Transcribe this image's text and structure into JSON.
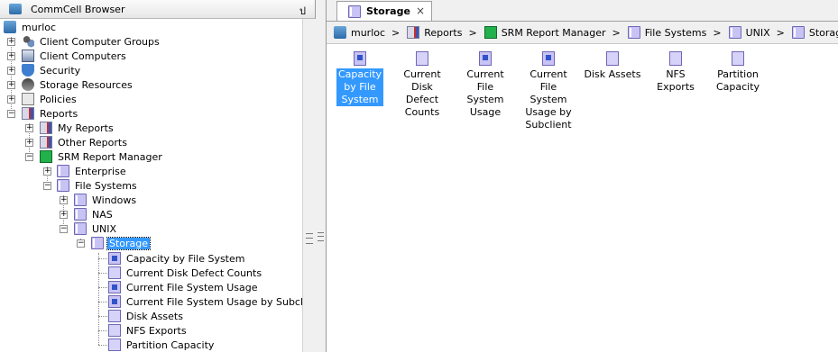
{
  "browser": {
    "title": "CommCell Browser",
    "pin_glyph": "ป",
    "tree": [
      {
        "label": "murloc",
        "icon": "commcell-icon"
      },
      {
        "label": "Client Computer Groups",
        "icon": "group-icon"
      },
      {
        "label": "Client Computers",
        "icon": "computer-icon"
      },
      {
        "label": "Security",
        "icon": "shield-icon"
      },
      {
        "label": "Storage Resources",
        "icon": "storage-icon"
      },
      {
        "label": "Policies",
        "icon": "policy-icon"
      },
      {
        "label": "Reports",
        "icon": "report-icon"
      },
      {
        "label": "My Reports",
        "icon": "report-icon"
      },
      {
        "label": "Other Reports",
        "icon": "report-icon"
      },
      {
        "label": "SRM Report Manager",
        "icon": "srm-icon"
      },
      {
        "label": "Enterprise",
        "icon": "folder-icon"
      },
      {
        "label": "File Systems",
        "icon": "folder-icon"
      },
      {
        "label": "Windows",
        "icon": "folder-icon"
      },
      {
        "label": "NAS",
        "icon": "folder-icon"
      },
      {
        "label": "UNIX",
        "icon": "folder-icon"
      },
      {
        "label": "Storage",
        "icon": "folder-icon"
      },
      {
        "label": "Capacity by File System",
        "icon": "report-item-icon"
      },
      {
        "label": "Current Disk Defect Counts",
        "icon": "report-item-icon"
      },
      {
        "label": "Current File System Usage",
        "icon": "report-item-icon"
      },
      {
        "label": "Current File System Usage by Subclient",
        "icon": "report-item-icon"
      },
      {
        "label": "Disk Assets",
        "icon": "report-item-icon"
      },
      {
        "label": "NFS Exports",
        "icon": "report-item-icon"
      },
      {
        "label": "Partition Capacity",
        "icon": "report-item-icon"
      }
    ]
  },
  "tab": {
    "label": "Storage",
    "close": "×"
  },
  "breadcrumb": {
    "items": [
      "murloc",
      "Reports",
      "SRM Report Manager",
      "File Systems",
      "UNIX",
      "Storage"
    ],
    "separator": ">"
  },
  "content": {
    "items": [
      {
        "label": "Capacity by File System",
        "lines": [
          "Capacity",
          "by File",
          "System"
        ]
      },
      {
        "label": "Current Disk Defect Counts",
        "lines": [
          "Current",
          "Disk",
          "Defect",
          "Counts"
        ]
      },
      {
        "label": "Current File System Usage",
        "lines": [
          "Current",
          "File",
          "System",
          "Usage"
        ]
      },
      {
        "label": "Current File System Usage by Subclient",
        "lines": [
          "Current",
          "File",
          "System",
          "Usage by",
          "Subclient"
        ]
      },
      {
        "label": "Disk Assets",
        "lines": [
          "Disk Assets"
        ]
      },
      {
        "label": "NFS Exports",
        "lines": [
          "NFS",
          "Exports"
        ]
      },
      {
        "label": "Partition Capacity",
        "lines": [
          "Partition",
          "Capacity"
        ]
      }
    ]
  },
  "colors": {
    "selection": "#3399ff",
    "srm": "#22b14c",
    "folder": "#c9c3f5"
  }
}
